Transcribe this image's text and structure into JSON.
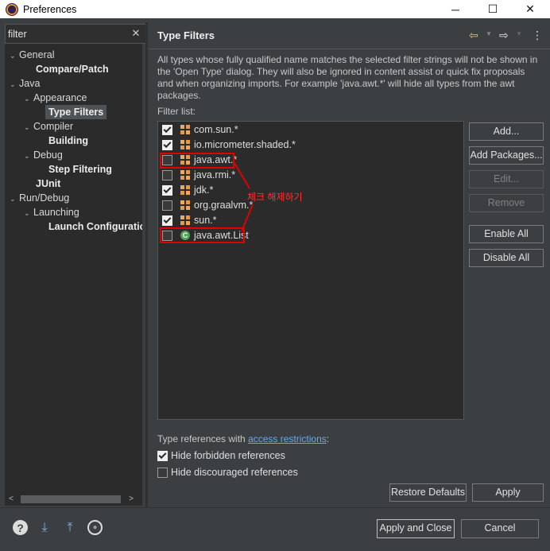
{
  "window": {
    "title": "Preferences",
    "minimize": "─",
    "maximize": "☐",
    "close": "✕"
  },
  "search": {
    "value": "filter",
    "clear": "✕"
  },
  "tree": [
    {
      "label": "General",
      "twisty": "⌄"
    },
    {
      "label": "Compare/Patch"
    },
    {
      "label": "Java",
      "twisty": "⌄"
    },
    {
      "label": "Appearance",
      "twisty": "⌄"
    },
    {
      "label": "Type Filters"
    },
    {
      "label": "Compiler",
      "twisty": "⌄"
    },
    {
      "label": "Building"
    },
    {
      "label": "Debug",
      "twisty": "⌄"
    },
    {
      "label": "Step Filtering"
    },
    {
      "label": "JUnit"
    },
    {
      "label": "Run/Debug",
      "twisty": "⌄"
    },
    {
      "label": "Launching",
      "twisty": "⌄"
    },
    {
      "label": "Launch Configuratio"
    }
  ],
  "scroll": {
    "left": "<",
    "right": ">"
  },
  "page": {
    "title": "Type Filters",
    "back_icon": "⇦",
    "forward_icon": "⇨",
    "menu_icon": "⋮",
    "description": "All types whose fully qualified name matches the selected filter strings will not be shown in the 'Open Type' dialog. They will also be ignored in content assist or quick fix proposals and when organizing imports. For example 'java.awt.*' will hide all types from the awt packages.",
    "filter_list_label": "Filter list:"
  },
  "filters": [
    {
      "label": "com.sun.*",
      "checked": true,
      "kind": "package"
    },
    {
      "label": "io.micrometer.shaded.*",
      "checked": true,
      "kind": "package"
    },
    {
      "label": "java.awt.*",
      "checked": false,
      "kind": "package"
    },
    {
      "label": "java.rmi.*",
      "checked": false,
      "kind": "package"
    },
    {
      "label": "jdk.*",
      "checked": true,
      "kind": "package"
    },
    {
      "label": "org.graalvm.*",
      "checked": false,
      "kind": "package"
    },
    {
      "label": "sun.*",
      "checked": true,
      "kind": "package"
    },
    {
      "label": "java.awt.List",
      "checked": false,
      "kind": "class"
    }
  ],
  "class_icon_glyph": "C",
  "annotation": {
    "text": "체크 해제하기",
    "color": "#e00000"
  },
  "buttons": {
    "add": "Add...",
    "add_packages": "Add Packages...",
    "edit": "Edit...",
    "remove": "Remove",
    "enable_all": "Enable All",
    "disable_all": "Disable All",
    "restore_defaults": "Restore Defaults",
    "apply": "Apply",
    "apply_and_close": "Apply and Close",
    "cancel": "Cancel"
  },
  "restrictions": {
    "prefix": "Type references with ",
    "link": "access restrictions",
    "suffix": ":",
    "hide_forbidden": {
      "label": "Hide forbidden references",
      "checked": true
    },
    "hide_discouraged": {
      "label": "Hide discouraged references",
      "checked": false
    }
  },
  "bottom_icons": {
    "help": "?",
    "import": "⤓",
    "export": "⤒",
    "record": "●"
  }
}
